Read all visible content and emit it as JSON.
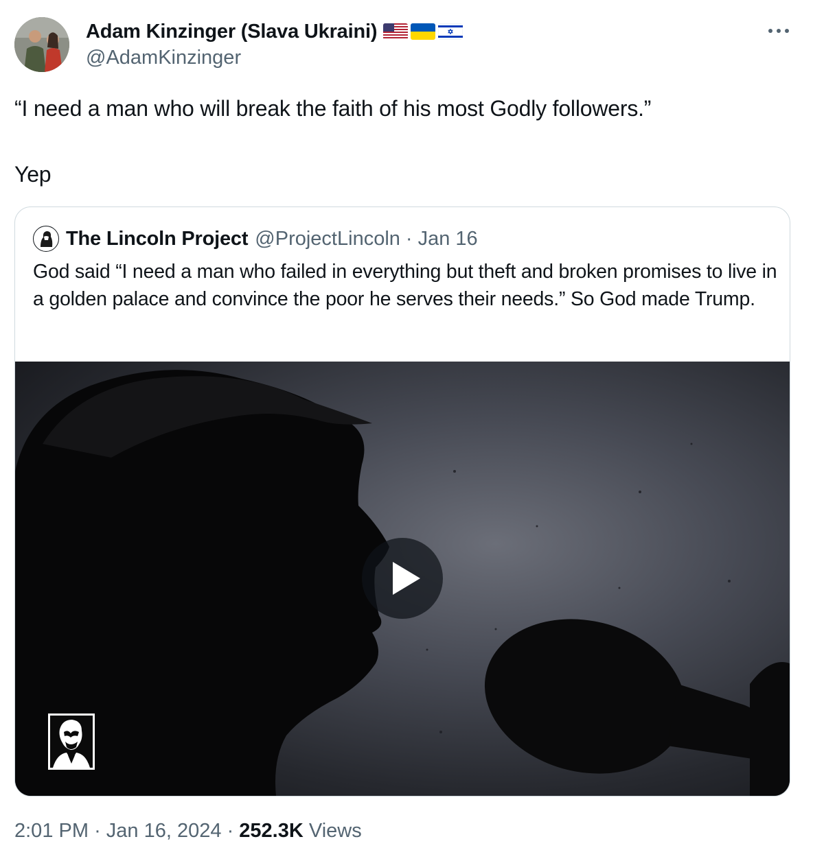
{
  "author": {
    "name": "Adam Kinzinger (Slava Ukraini)",
    "handle": "@AdamKinzinger",
    "flags": [
      "us-flag-icon",
      "ukraine-flag-icon",
      "israel-flag-icon"
    ]
  },
  "tweet": {
    "text": "“I need a man who will break the faith of his most Godly followers.”\n\nYep"
  },
  "quoted_tweet": {
    "author_name": "The Lincoln Project",
    "handle": "@ProjectLincoln",
    "separator": "·",
    "date": "Jan 16",
    "text": "God said “I need a man who failed in everything but theft and broken promises to live in a golden palace and convince the poor he serves their needs.” So God made Trump.",
    "media": {
      "type": "video",
      "play_icon": "play-icon",
      "watermark_icon": "lincoln-project-logo-icon"
    }
  },
  "meta": {
    "time": "2:01 PM",
    "separator": "·",
    "date": "Jan 16, 2024",
    "views_count": "252.3K",
    "views_label": "Views"
  },
  "colors": {
    "text": "#0f1419",
    "secondary": "#536471",
    "border": "#cfd9de"
  }
}
